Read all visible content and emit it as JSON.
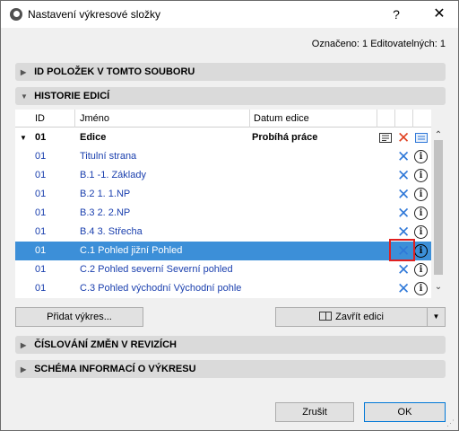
{
  "window": {
    "title": "Nastavení výkresové složky",
    "help_label": "?",
    "close_label": "✕"
  },
  "status": {
    "marked": "Označeno: 1 Editovatelných: 1"
  },
  "sections": {
    "ids": "ID POLOŽEK V TOMTO SOUBORU",
    "history": "HISTORIE EDICÍ",
    "revisions": "ČÍSLOVÁNÍ ZMĚN V REVIZÍCH",
    "schema": "SCHÉMA INFORMACÍ O VÝKRESU"
  },
  "table": {
    "headers": {
      "id": "ID",
      "name": "Jméno",
      "date": "Datum edice"
    },
    "group": {
      "id": "01",
      "name": "Edice",
      "date": "Probíhá práce"
    },
    "rows": [
      {
        "id": "01",
        "name": "Titulní strana"
      },
      {
        "id": "01",
        "name": "B.1 -1. Základy"
      },
      {
        "id": "01",
        "name": "B.2 1. 1.NP"
      },
      {
        "id": "01",
        "name": "B.3 2. 2.NP"
      },
      {
        "id": "01",
        "name": "B.4 3. Střecha"
      },
      {
        "id": "01",
        "name": "C.1 Pohled jižní Pohled"
      },
      {
        "id": "01",
        "name": "C.2 Pohled severní Severní pohled"
      },
      {
        "id": "01",
        "name": "C.3 Pohled východní Východní pohle"
      }
    ],
    "selected_index": 5
  },
  "buttons": {
    "add_drawing": "Přidat výkres...",
    "close_edition": "Zavřít edici",
    "cancel": "Zrušit",
    "ok": "OK"
  },
  "icons": {
    "remove": "✕",
    "info": "i",
    "collapse_open": "▼",
    "collapse_closed": "▶",
    "scroll_up": "⌃",
    "scroll_down": "⌄"
  },
  "colors": {
    "selection": "#3c8fd8",
    "link_text": "#1a3fae",
    "remove_icon": "#2f78d8",
    "group_remove_icon": "#e04020",
    "highlight": "#e02020"
  }
}
